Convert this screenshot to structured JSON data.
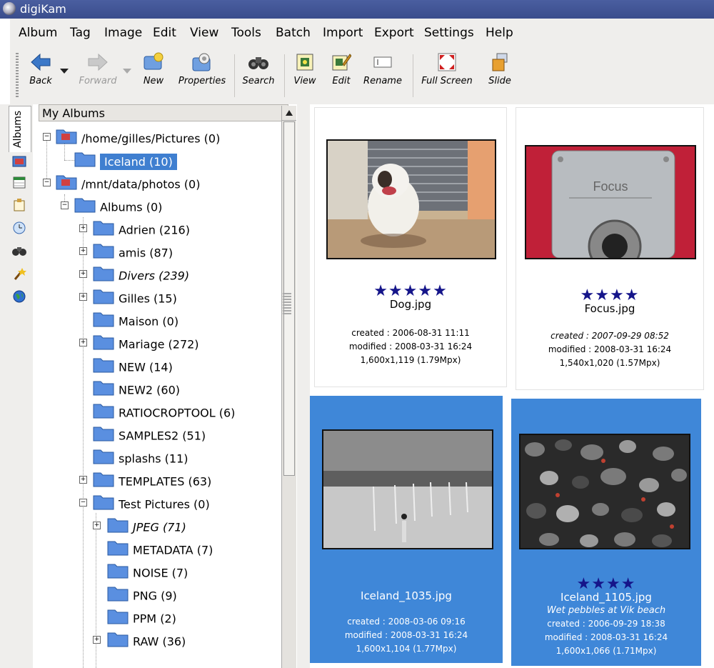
{
  "window": {
    "title": "digiKam"
  },
  "menu": [
    "Album",
    "Tag",
    "Image",
    "Edit",
    "View",
    "Tools",
    "Batch",
    "Import",
    "Export",
    "Settings",
    "Help"
  ],
  "toolbar": {
    "back": "Back",
    "forward": "Forward",
    "new": "New",
    "properties": "Properties",
    "search": "Search",
    "view": "View",
    "edit": "Edit",
    "rename": "Rename",
    "fullscreen": "Full Screen",
    "slide": "Slide"
  },
  "sidebar": {
    "albums_tab": "Albums"
  },
  "tree": {
    "header": "My Albums",
    "nodes": [
      {
        "label": "/home/gilles/Pictures (0)"
      },
      {
        "label": "Iceland (10)"
      },
      {
        "label": "/mnt/data/photos (0)"
      },
      {
        "label": "Albums (0)"
      },
      {
        "label": "Adrien (216)"
      },
      {
        "label": "amis (87)"
      },
      {
        "label": "Divers (239)"
      },
      {
        "label": "Gilles (15)"
      },
      {
        "label": "Maison (0)"
      },
      {
        "label": "Mariage (272)"
      },
      {
        "label": "NEW (14)"
      },
      {
        "label": "NEW2 (60)"
      },
      {
        "label": "RATIOCROPTOOL (6)"
      },
      {
        "label": "SAMPLES2 (51)"
      },
      {
        "label": "splashs (11)"
      },
      {
        "label": "TEMPLATES (63)"
      },
      {
        "label": "Test Pictures (0)"
      },
      {
        "label": "JPEG (71)"
      },
      {
        "label": "METADATA (7)"
      },
      {
        "label": "NOISE (7)"
      },
      {
        "label": "PNG (9)"
      },
      {
        "label": "PPM (2)"
      },
      {
        "label": "RAW (36)"
      }
    ]
  },
  "thumbs": [
    {
      "stars": "★★★★★",
      "rating": 5,
      "name": "Dog.jpg",
      "comment": "",
      "created": "created : 2006-08-31 11:11",
      "modified": "modified : 2008-03-31 16:24",
      "size": "1,600x1,119 (1.79Mpx)"
    },
    {
      "stars": "★★★★",
      "rating": 4,
      "name": "Focus.jpg",
      "comment": "",
      "created": "created : 2007-09-29 08:52",
      "modified": "modified : 2008-03-31 16:24",
      "size": "1,540x1,020 (1.57Mpx)",
      "photo_text": "Focus"
    },
    {
      "stars": "",
      "rating": 0,
      "name": "Iceland_1035.jpg",
      "comment": "",
      "created": "created : 2008-03-06 09:16",
      "modified": "modified : 2008-03-31 16:24",
      "size": "1,600x1,104 (1.77Mpx)"
    },
    {
      "stars": "★★★★",
      "rating": 4,
      "name": "Iceland_1105.jpg",
      "comment": "Wet pebbles at Vik beach",
      "created": "created : 2006-09-29 18:38",
      "modified": "modified : 2008-03-31 16:24",
      "size": "1,600x1,066 (1.71Mpx)"
    }
  ]
}
